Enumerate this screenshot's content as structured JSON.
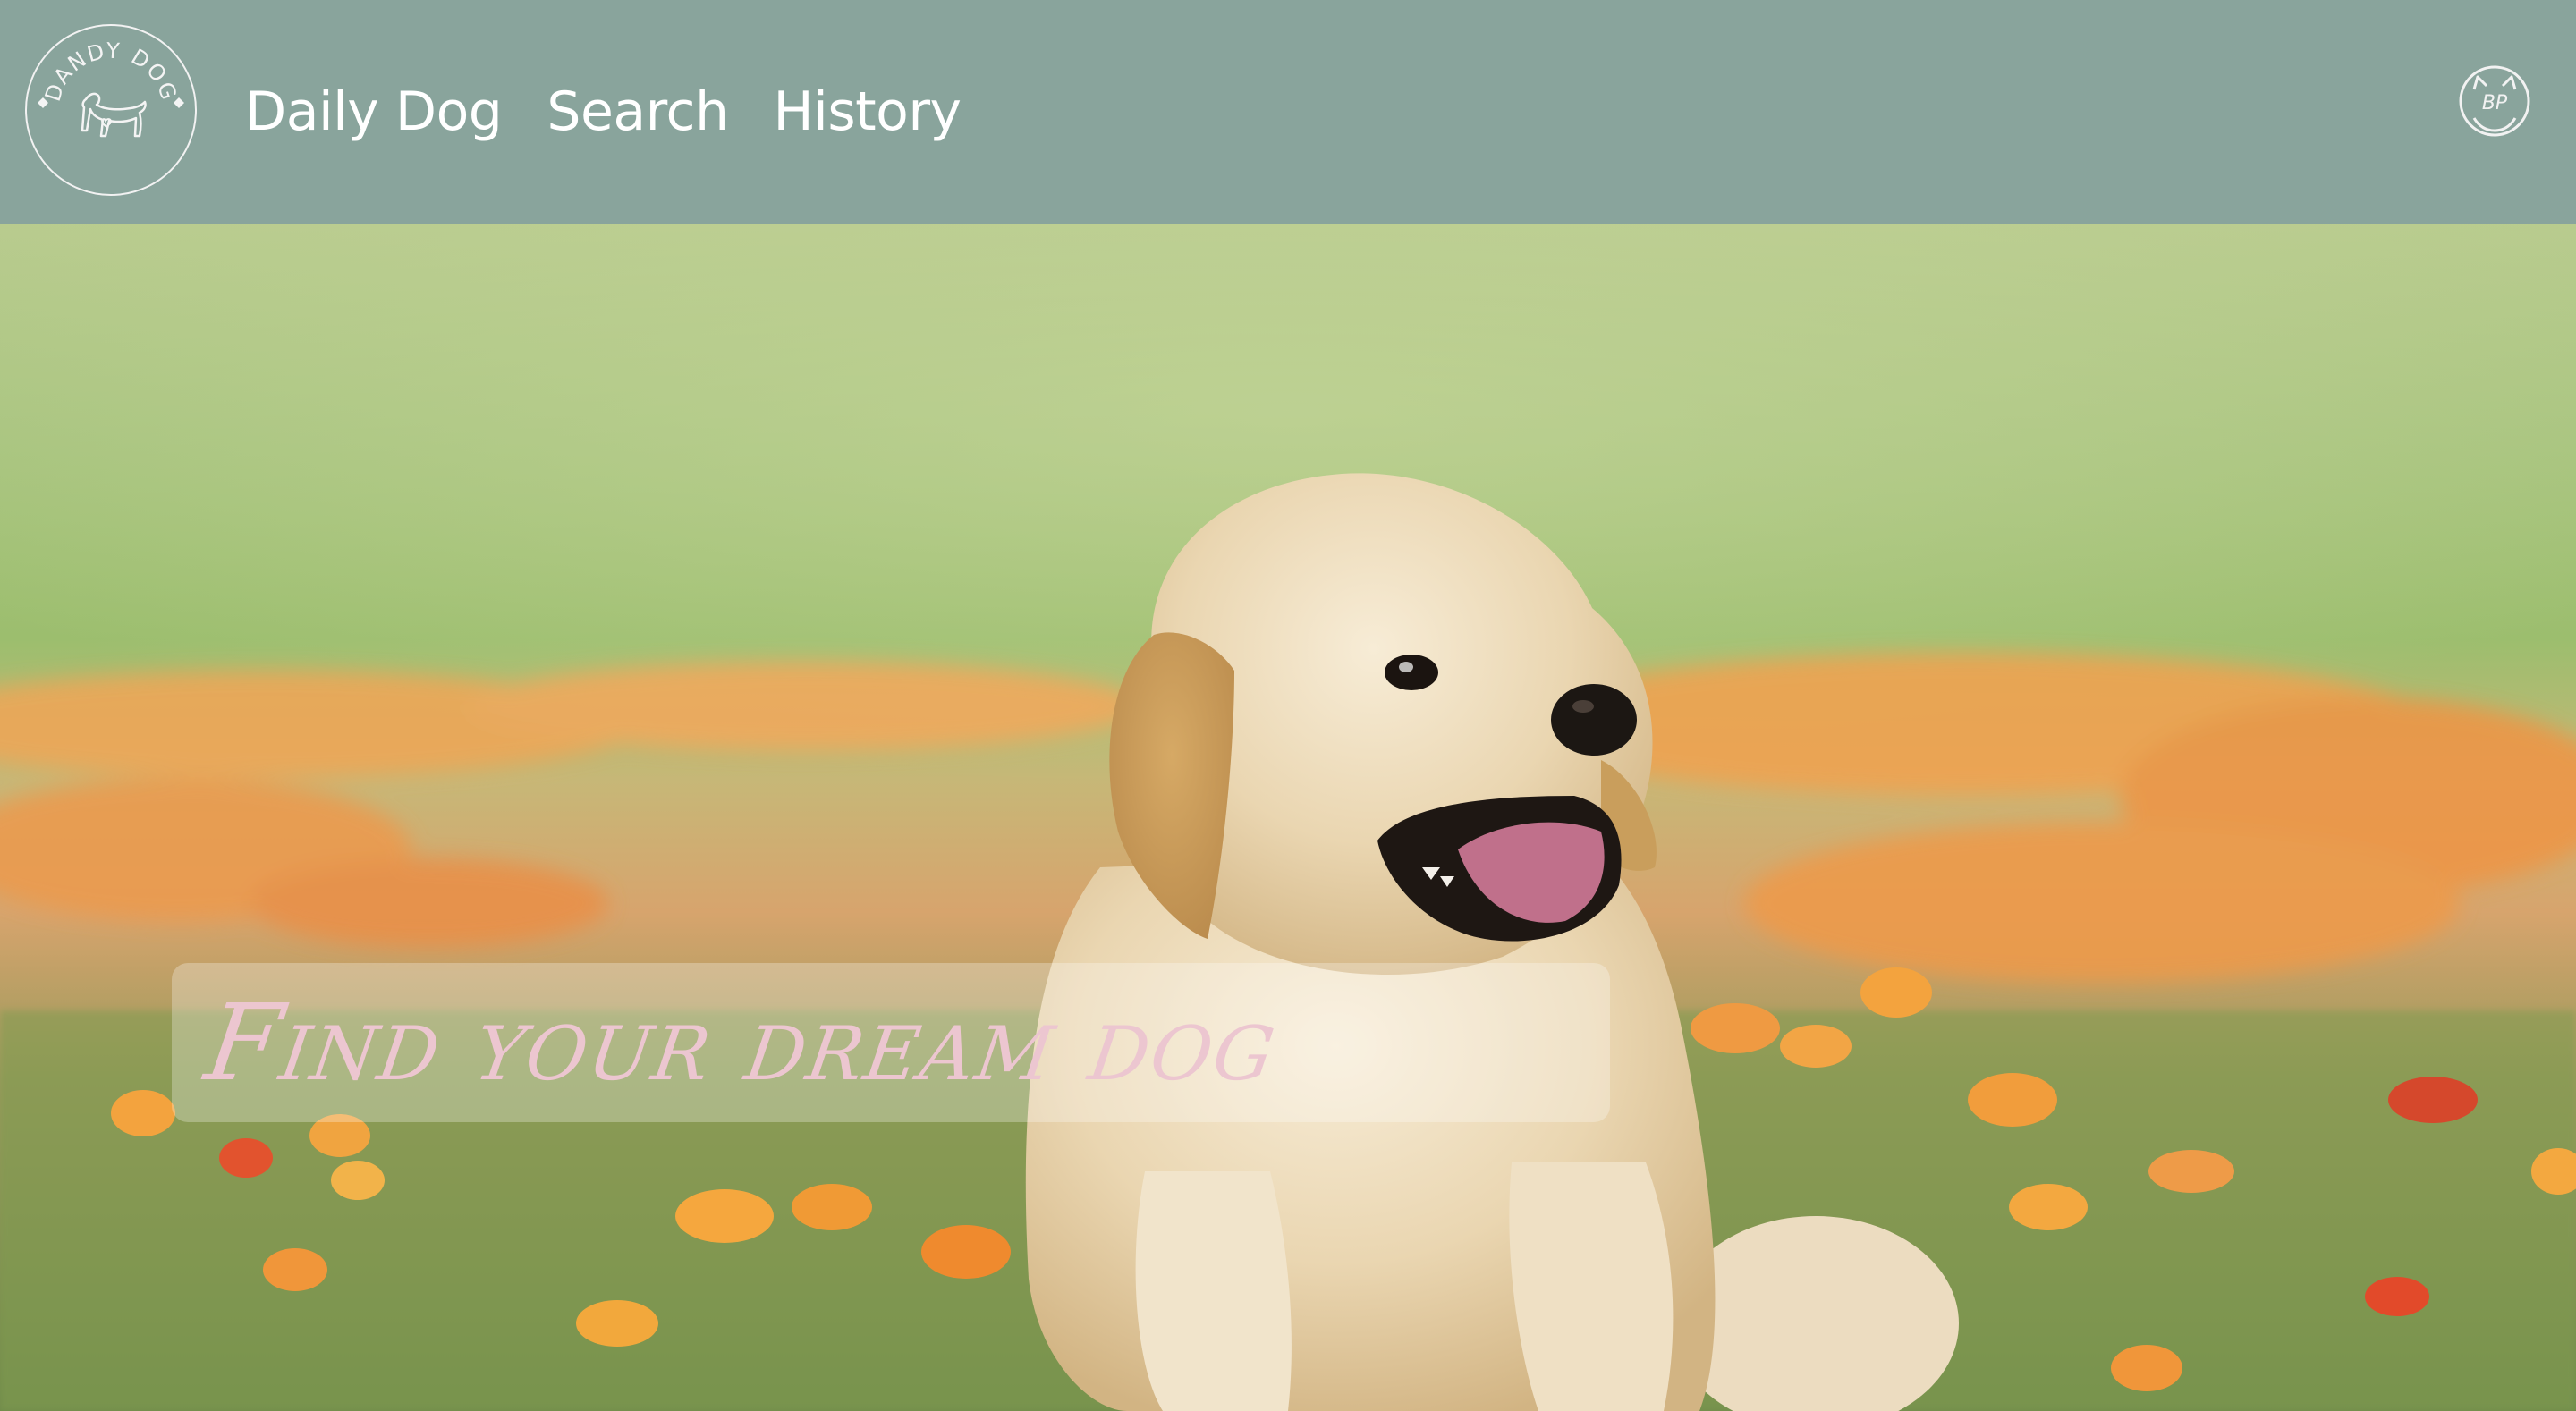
{
  "header": {
    "background": "#89a49c",
    "logo": {
      "text": "DANDY DOG",
      "icon": "dog-logo-icon"
    },
    "nav": [
      {
        "label": "Daily Dog"
      },
      {
        "label": "Search"
      },
      {
        "label": "History"
      }
    ],
    "profile": {
      "initials": "BP",
      "icon": "profile-avatar-icon"
    }
  },
  "hero": {
    "tagline": "Find your dream dog",
    "tagline_color": "#ecc6d0",
    "image": "golden-retriever-puppy-in-flower-field"
  }
}
